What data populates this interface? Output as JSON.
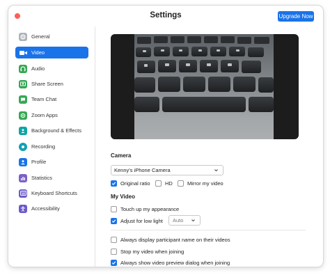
{
  "window": {
    "title": "Settings",
    "upgrade_label": "Upgrade Now"
  },
  "colors": {
    "accent": "#1a73e8",
    "close": "#fe5f57"
  },
  "sidebar": {
    "selected": "Video",
    "items": [
      {
        "label": "General",
        "icon": "gear-icon",
        "color": "#9aa0a6"
      },
      {
        "label": "Video",
        "icon": "video-camera-icon",
        "color": "#1a73e8"
      },
      {
        "label": "Audio",
        "icon": "headphones-icon",
        "color": "#34a853"
      },
      {
        "label": "Share Screen",
        "icon": "share-screen-icon",
        "color": "#34a853"
      },
      {
        "label": "Team Chat",
        "icon": "chat-bubble-icon",
        "color": "#34a853"
      },
      {
        "label": "Zoom Apps",
        "icon": "apps-icon",
        "color": "#34a853"
      },
      {
        "label": "Background & Effects",
        "icon": "person-background-icon",
        "color": "#0fa5a5"
      },
      {
        "label": "Recording",
        "icon": "record-icon",
        "color": "#13a0b4"
      },
      {
        "label": "Profile",
        "icon": "person-icon",
        "color": "#1a73e8"
      },
      {
        "label": "Statistics",
        "icon": "statistics-icon",
        "color": "#7b61c4"
      },
      {
        "label": "Keyboard Shortcuts",
        "icon": "keyboard-icon",
        "color": "#6a5acd"
      },
      {
        "label": "Accessibility",
        "icon": "accessibility-icon",
        "color": "#6a5acd"
      }
    ]
  },
  "camera": {
    "section_label": "Camera",
    "selected_camera": "Kenny's iPhone Camera",
    "original_ratio": {
      "label": "Original ratio",
      "checked": true
    },
    "hd": {
      "label": "HD",
      "checked": false
    },
    "mirror": {
      "label": "Mirror my video",
      "checked": false
    }
  },
  "my_video": {
    "section_label": "My Video",
    "touch_up": {
      "label": "Touch up my appearance",
      "checked": false
    },
    "low_light": {
      "label": "Adjust for low light",
      "checked": true,
      "mode": "Auto"
    }
  },
  "options": {
    "display_name": {
      "label": "Always display participant name on their videos",
      "checked": false
    },
    "stop_video": {
      "label": "Stop my video when joining",
      "checked": false
    },
    "preview_dialog": {
      "label": "Always show video preview dialog when joining",
      "checked": true
    }
  }
}
